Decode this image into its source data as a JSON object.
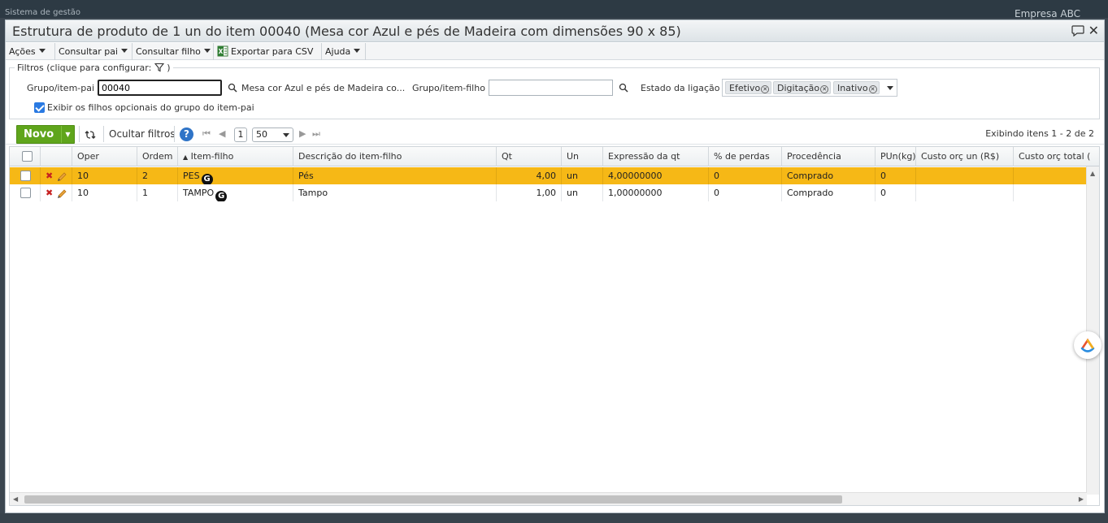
{
  "background": {
    "app_name": "Sistema de gestão",
    "company": "Empresa ABC"
  },
  "dialog": {
    "title": "Estrutura de produto de 1 un do item 00040 (Mesa cor Azul e pés de Madeira com dimensões 90 x 85)",
    "close_glyph": "✕"
  },
  "menu": {
    "acoes": "Ações",
    "consultar_pai": "Consultar pai",
    "consultar_filho": "Consultar filho",
    "exportar_csv": "Exportar para CSV",
    "ajuda": "Ajuda"
  },
  "filters": {
    "legend": "Filtros (clique para configurar:",
    "legend_close": ")",
    "grupo_pai_label": "Grupo/item-pai",
    "grupo_pai_value": "00040",
    "grupo_pai_desc": "Mesa cor Azul e pés de Madeira co...",
    "grupo_filho_label": "Grupo/item-filho",
    "grupo_filho_value": "",
    "estado_label": "Estado da ligação",
    "estado_tags": [
      "Efetivo",
      "Digitação",
      "Inativo"
    ],
    "exibir_opcionais_label": "Exibir os filhos opcionais do grupo do item-pai",
    "exibir_opcionais_checked": true
  },
  "toolbar": {
    "novo": "Novo",
    "ocultar_filtros": "Ocultar filtros",
    "help": "?",
    "page": "1",
    "page_size": "50",
    "summary": "Exibindo itens 1 - 2 de 2"
  },
  "grid": {
    "columns": [
      "Oper",
      "Ordem",
      "Item-filho",
      "Descrição do item-filho",
      "Qt",
      "Un",
      "Expressão da qt",
      "% de perdas",
      "Procedência",
      "PUn(kg)",
      "Custo orç un (R$)",
      "Custo orç total ("
    ],
    "sort_indicator": "▲",
    "rows": [
      {
        "oper": "10",
        "ordem": "2",
        "item": "PES",
        "desc": "Pés",
        "qt": "4,00",
        "un": "un",
        "expr": "4,00000000",
        "perdas": "0",
        "proc": "Comprado",
        "pun": "0",
        "custo_un": "",
        "custo_total": "",
        "selected": true
      },
      {
        "oper": "10",
        "ordem": "1",
        "item": "TAMPO",
        "desc": "Tampo",
        "qt": "1,00",
        "un": "un",
        "expr": "1,00000000",
        "perdas": "0",
        "proc": "Comprado",
        "pun": "0",
        "custo_un": "",
        "custo_total": "",
        "selected": false
      }
    ],
    "item_badge": "G",
    "delete_glyph": "✖"
  },
  "colors": {
    "selected_row": "#f6b816",
    "novo_button": "#5fa51b",
    "help_icon": "#2f74c7"
  }
}
